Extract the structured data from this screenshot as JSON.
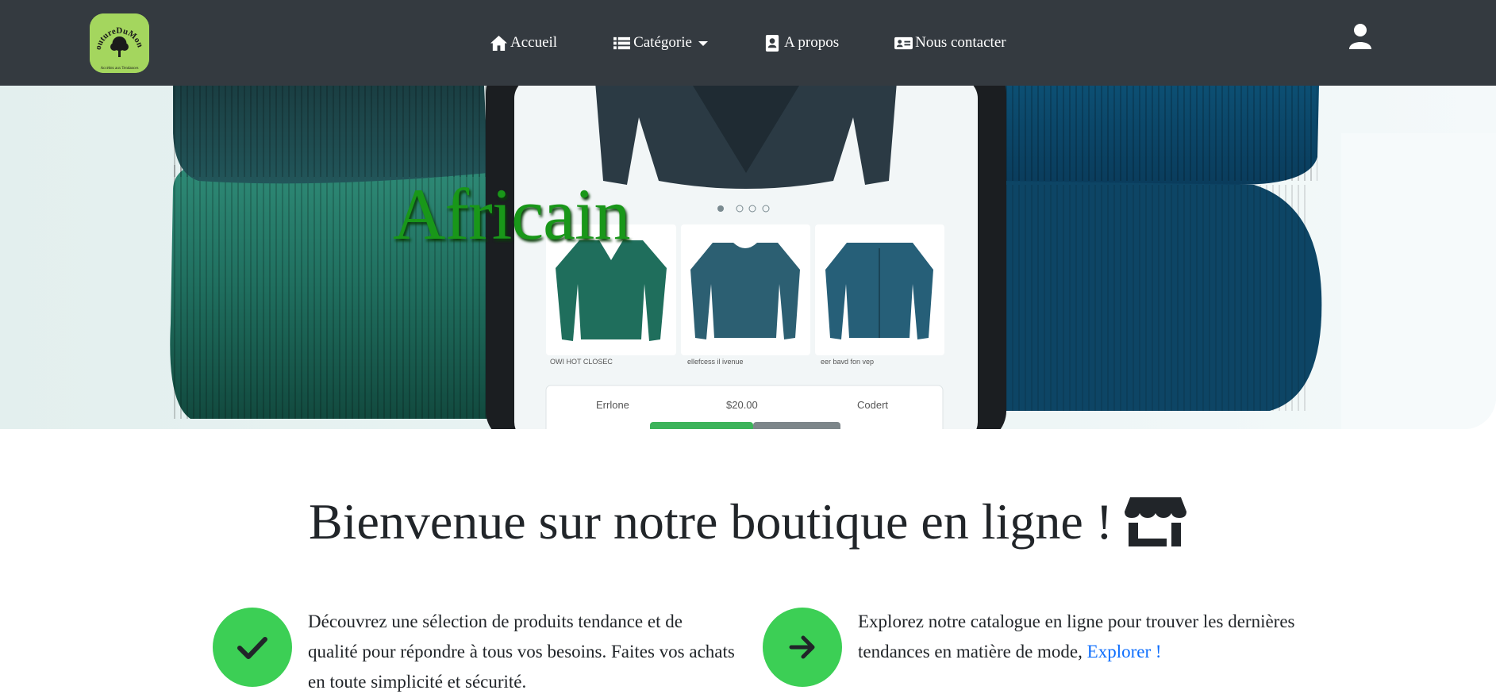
{
  "nav": {
    "logo": {
      "text_top": "CoutureDuMonde",
      "text_bottom": "Accédez aux Tendances",
      "icon": "logo-tree-badge"
    },
    "links": [
      {
        "label": "Accueil",
        "icon": "home-icon"
      },
      {
        "label": "Catégorie",
        "icon": "list-icon",
        "dropdown": true
      },
      {
        "label": "A propos",
        "icon": "address-book-icon"
      },
      {
        "label": "Nous contacter",
        "icon": "id-card-icon"
      }
    ],
    "user_icon": "user-icon"
  },
  "hero": {
    "title": "Africain",
    "mock_product_labels": [
      "OWI HOT CLOSEC",
      "ellefcess il ivenue",
      "eer bavd fon vep"
    ],
    "mock_price_row": [
      "Errlone",
      "$20.00",
      "Codert"
    ]
  },
  "welcome": {
    "title": "Bienvenue sur notre boutique en ligne !",
    "icon": "shop-icon"
  },
  "features": [
    {
      "icon": "check-icon",
      "text": "Découvrez une sélection de produits tendance et de qualité pour répondre à tous vos besoins. Faites vos achats en toute simplicité et sécurité."
    },
    {
      "icon": "arrow-right-icon",
      "text": "Explorez notre catalogue en ligne pour trouver les dernières tendances en matière de mode,",
      "link_label": "Explorer !"
    }
  ],
  "colors": {
    "navbar_bg": "#343a40",
    "accent_green": "#3ccf55",
    "title_green": "#199719",
    "link_blue": "#0d6efd",
    "logo_bg": "#a4d65e"
  }
}
